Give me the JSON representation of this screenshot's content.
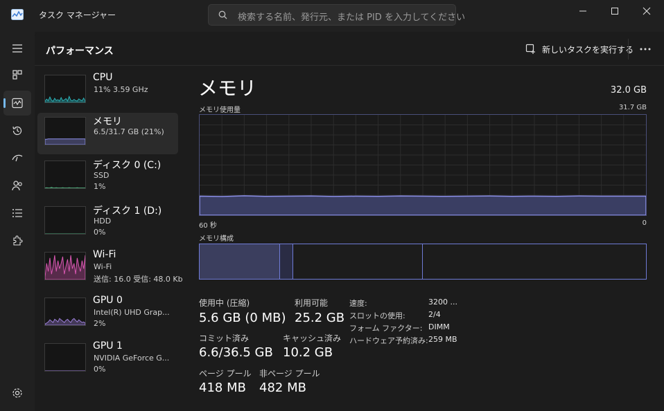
{
  "window": {
    "title": "タスク マネージャー",
    "search_placeholder": "検索する名前、発行元、または PID を入力してください"
  },
  "nav": {
    "items": [
      {
        "name": "menu-icon"
      },
      {
        "name": "processes-icon"
      },
      {
        "name": "performance-icon",
        "active": true
      },
      {
        "name": "app-history-icon"
      },
      {
        "name": "startup-apps-icon"
      },
      {
        "name": "users-icon"
      },
      {
        "name": "details-icon"
      },
      {
        "name": "services-icon"
      },
      {
        "name": "settings-icon"
      }
    ]
  },
  "header": {
    "title": "パフォーマンス",
    "run_task_label": "新しいタスクを実行する"
  },
  "perf_list": [
    {
      "name": "CPU",
      "line1": "11%  3.59 GHz",
      "line2": "",
      "line3": "",
      "color": "#2bb2b8",
      "history": [
        0.05,
        0.12,
        0.06,
        0.2,
        0.08,
        0.04,
        0.15,
        0.07,
        0.1,
        0.05,
        0.18,
        0.06,
        0.09,
        0.14,
        0.05,
        0.22,
        0.08,
        0.06,
        0.11,
        0.07,
        0.05,
        0.13,
        0.09,
        0.06,
        0.16,
        0.05
      ]
    },
    {
      "name": "メモリ",
      "line1": "6.5/31.7 GB (21%)",
      "line2": "",
      "line3": "",
      "color": "#8b8fe8",
      "selected": true,
      "history": [
        0.2,
        0.2,
        0.21,
        0.21,
        0.21,
        0.21,
        0.21,
        0.21,
        0.21,
        0.21,
        0.21,
        0.21,
        0.21,
        0.21,
        0.21,
        0.21,
        0.21,
        0.21,
        0.21,
        0.21,
        0.21,
        0.21,
        0.21,
        0.21,
        0.21,
        0.21
      ]
    },
    {
      "name": "ディスク 0 (C:)",
      "line1": "SSD",
      "line2": "1%",
      "line3": "",
      "color": "#4fa87a",
      "history": [
        0.01,
        0.02,
        0.01,
        0.01,
        0.03,
        0.01,
        0.01,
        0.02,
        0.01,
        0.01,
        0.01,
        0.02,
        0.01,
        0.01,
        0.01,
        0.02,
        0.01,
        0.01,
        0.01,
        0.01,
        0.02,
        0.01,
        0.01,
        0.01,
        0.01,
        0.01
      ]
    },
    {
      "name": "ディスク 1 (D:)",
      "line1": "HDD",
      "line2": "0%",
      "line3": "",
      "color": "#4fa87a",
      "history": [
        0,
        0,
        0,
        0,
        0,
        0,
        0,
        0,
        0,
        0,
        0,
        0,
        0,
        0,
        0,
        0,
        0,
        0,
        0,
        0,
        0,
        0,
        0,
        0,
        0,
        0
      ]
    },
    {
      "name": "Wi-Fi",
      "line1": "Wi-Fi",
      "line2": "送信: 16.0  受信: 48.0 Kb",
      "line3": "",
      "color": "#d857b1",
      "history": [
        0.1,
        0.6,
        0.3,
        0.8,
        0.2,
        0.5,
        0.9,
        0.3,
        0.7,
        0.4,
        0.6,
        0.85,
        0.2,
        0.5,
        0.75,
        0.3,
        0.9,
        0.4,
        0.6,
        0.2,
        0.8,
        0.5,
        0.3,
        0.7,
        0.4,
        0.9
      ]
    },
    {
      "name": "GPU 0",
      "line1": "Intel(R) UHD Grap...",
      "line2": "2%",
      "line3": "",
      "color": "#9b7fd8",
      "history": [
        0.05,
        0.08,
        0.12,
        0.2,
        0.15,
        0.1,
        0.22,
        0.18,
        0.12,
        0.25,
        0.2,
        0.15,
        0.1,
        0.18,
        0.22,
        0.15,
        0.1,
        0.2,
        0.25,
        0.18,
        0.12,
        0.2,
        0.15,
        0.1,
        0.12,
        0.08
      ]
    },
    {
      "name": "GPU 1",
      "line1": "NVIDIA GeForce G...",
      "line2": "0%",
      "line3": "",
      "color": "#9b7fd8",
      "history": [
        0,
        0,
        0,
        0,
        0,
        0,
        0,
        0,
        0,
        0,
        0,
        0,
        0,
        0,
        0,
        0,
        0,
        0,
        0,
        0,
        0,
        0,
        0,
        0,
        0,
        0
      ]
    }
  ],
  "detail": {
    "title": "メモリ",
    "total": "32.0 GB",
    "usage_label": "メモリ使用量",
    "usage_max": "31.7 GB",
    "axis_left": "60 秒",
    "axis_right": "0",
    "composition_label": "メモリ構成",
    "usage_fraction": 0.19,
    "composition": [
      {
        "fraction": 0.18,
        "fill": "#3b3e5e"
      },
      {
        "fraction": 0.03,
        "fill": "#2a2c44"
      },
      {
        "fraction": 0.29,
        "fill": "transparent"
      },
      {
        "fraction": 0.5,
        "fill": "transparent"
      }
    ],
    "stats": {
      "in_use_label": "使用中 (圧縮)",
      "in_use_value": "5.6 GB (0 MB)",
      "available_label": "利用可能",
      "available_value": "25.2 GB",
      "committed_label": "コミット済み",
      "committed_value": "6.6/36.5 GB",
      "cached_label": "キャッシュ済み",
      "cached_value": "10.2 GB",
      "paged_label": "ページ プール",
      "paged_value": "418 MB",
      "nonpaged_label": "非ページ プール",
      "nonpaged_value": "482 MB"
    },
    "specs": [
      {
        "label": "速度:",
        "value": "3200 ..."
      },
      {
        "label": "スロットの使用:",
        "value": "2/4"
      },
      {
        "label": "フォーム ファクター:",
        "value": "DIMM"
      },
      {
        "label": "ハードウェア予約済み:",
        "value": "259 MB"
      }
    ]
  }
}
